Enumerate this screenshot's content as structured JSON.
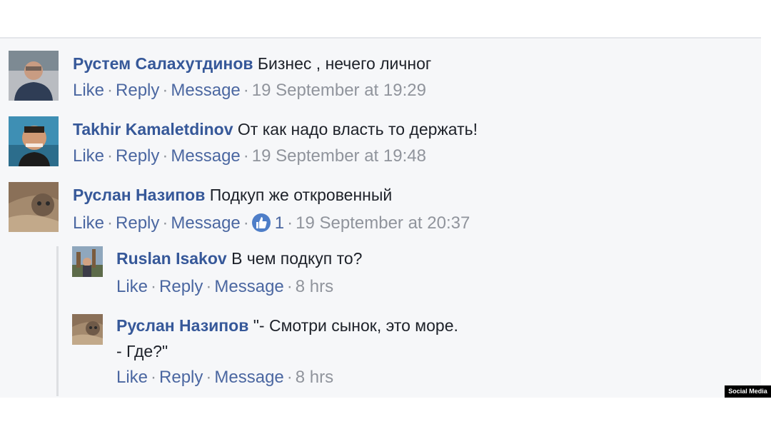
{
  "comments": [
    {
      "author": "Рустем Салахутдинов",
      "text": "Бизнес , нечего личног",
      "actions": {
        "like": "Like",
        "reply": "Reply",
        "message": "Message"
      },
      "timestamp": "19 September at 19:29"
    },
    {
      "author": "Takhir Kamaletdinov",
      "text": "От как надо власть то держать!",
      "actions": {
        "like": "Like",
        "reply": "Reply",
        "message": "Message"
      },
      "timestamp": "19 September at 19:48"
    },
    {
      "author": "Руслан Назипов",
      "text": "Подкуп же откровенный",
      "actions": {
        "like": "Like",
        "reply": "Reply",
        "message": "Message"
      },
      "like_count": "1",
      "timestamp": "19 September at 20:37"
    }
  ],
  "replies": [
    {
      "author": "Ruslan Isakov",
      "text": "В чем подкуп то?",
      "actions": {
        "like": "Like",
        "reply": "Reply",
        "message": "Message"
      },
      "timestamp": "8 hrs"
    },
    {
      "author": "Руслан Назипов",
      "text": "\"- Смотри сынок, это море.",
      "text_line2": "- Где?\"",
      "actions": {
        "like": "Like",
        "reply": "Reply",
        "message": "Message"
      },
      "timestamp": "8 hrs"
    }
  ],
  "separator": "·",
  "watermark": "Social Media",
  "colors": {
    "author": "#365899",
    "link": "#4b67a1",
    "muted": "#90949c",
    "background": "#f6f7f9",
    "like_badge": "#4e7ec8"
  }
}
